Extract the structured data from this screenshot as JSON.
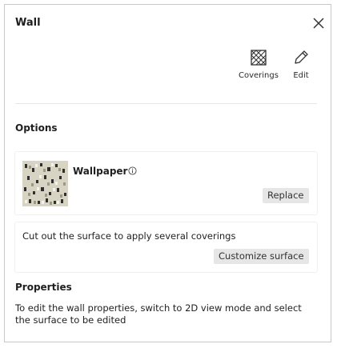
{
  "panel": {
    "title": "Wall",
    "close_icon": "close-icon"
  },
  "toolbar": {
    "coverings_label": "Coverings",
    "coverings_icon": "hatched-square-icon",
    "edit_label": "Edit",
    "edit_icon": "pencil-icon"
  },
  "options": {
    "heading": "Options",
    "wallpaper": {
      "name": "Wallpaper",
      "info_icon": "info-icon",
      "replace_label": "Replace"
    },
    "customize": {
      "text": "Cut out the surface to apply several coverings",
      "button_label": "Customize surface"
    }
  },
  "properties": {
    "heading": "Properties",
    "text": "To edit the wall properties, switch to 2D view mode and select the surface to be edited"
  }
}
